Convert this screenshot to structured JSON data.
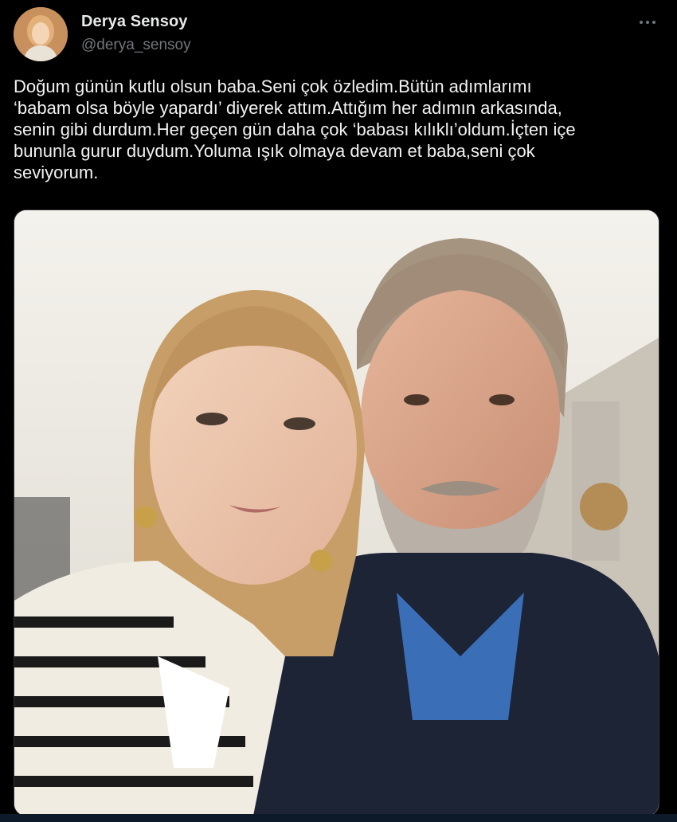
{
  "tweet": {
    "display_name": "Derya Sensoy",
    "handle": "@derya_sensoy",
    "text": "Doğum günün kutlu olsun baba.Seni çok özledim.Bütün adımlarımı\n‘babam olsa böyle yapardı’ diyerek attım.Attığım her adımın arkasında,\nsenin gibi durdum.Her geçen gün daha çok ‘babası kılıklı’oldum.İçten içe\nbununla gurur duydum.Yoluma ışık olmaya devam et baba,seni çok\nseviyorum."
  },
  "icons": {
    "more": "more-horizontal-icon"
  },
  "colors": {
    "background": "#000000",
    "text": "#e7e9ea",
    "secondary": "#71767b"
  }
}
